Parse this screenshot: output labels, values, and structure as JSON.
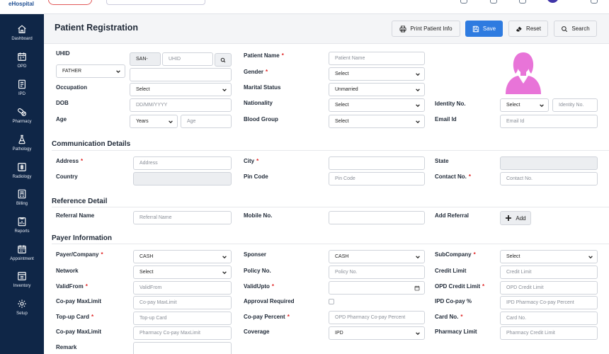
{
  "app": {
    "logo_text": "eHospital"
  },
  "sidebar": {
    "items": [
      {
        "label": "Dashboard",
        "icon": "home-icon"
      },
      {
        "label": "OPD",
        "icon": "calendar-icon"
      },
      {
        "label": "IPD",
        "icon": "document-icon"
      },
      {
        "label": "Pharmacy",
        "icon": "pills-icon"
      },
      {
        "label": "Pathology",
        "icon": "flask-icon"
      },
      {
        "label": "Radiology",
        "icon": "radiology-icon"
      },
      {
        "label": "Billing",
        "icon": "billing-icon"
      },
      {
        "label": "Reports",
        "icon": "reports-icon"
      },
      {
        "label": "Appointment",
        "icon": "appointment-icon"
      },
      {
        "label": "Inventory",
        "icon": "inventory-icon"
      },
      {
        "label": "Setup",
        "icon": "gear-icon"
      }
    ]
  },
  "header": {
    "title": "Patient Registration",
    "print_label": "Print Patient Info",
    "save_label": "Save",
    "reset_label": "Reset",
    "search_label": "Search"
  },
  "patient": {
    "uhid_label": "UHID",
    "uhid_prefix": "SAN-",
    "uhid_placeholder": "UHID",
    "relation_value": "FATHER",
    "patient_name_label": "Patient Name",
    "patient_name_placeholder": "Patient Name",
    "gender_label": "Gender",
    "gender_value": "Select",
    "occupation_label": "Occupation",
    "occupation_value": "Select",
    "marital_label": "Marital Status",
    "marital_value": "Unmarried",
    "dob_label": "DOB",
    "dob_placeholder": "DD/MM/YYYY",
    "nationality_label": "Nationality",
    "nationality_value": "Select",
    "identity_label": "Identity No.",
    "identity_type_value": "Select",
    "identity_placeholder": "Identity No.",
    "age_label": "Age",
    "age_unit_value": "Years",
    "age_placeholder": "Age",
    "blood_label": "Blood Group",
    "blood_value": "Select",
    "email_label": "Email Id",
    "email_placeholder": "Email Id"
  },
  "communication": {
    "title": "Communication Details",
    "address_label": "Address",
    "address_placeholder": "Address",
    "city_label": "City",
    "state_label": "State",
    "country_label": "Country",
    "pincode_label": "Pin Code",
    "pincode_placeholder": "Pin Code",
    "contact_label": "Contact No.",
    "contact_placeholder": "Contact No."
  },
  "reference": {
    "title": "Reference Detail",
    "referral_label": "Referral Name",
    "referral_placeholder": "Referral Name",
    "mobile_label": "Mobile No.",
    "add_referral_label": "Add Referral",
    "add_button": "Add"
  },
  "payer": {
    "title": "Payer Information",
    "payer_label": "Payer/Company",
    "payer_value": "CASH",
    "sponser_label": "Sponser",
    "sponser_value": "CASH",
    "subcompany_label": "SubCompany",
    "subcompany_value": "Select",
    "network_label": "Network",
    "network_value": "Select",
    "policy_label": "Policy No.",
    "policy_placeholder": "Policy No.",
    "credit_limit_label": "Credit Limit",
    "credit_limit_placeholder": "Credit Limit",
    "validfrom_label": "ValidFrom",
    "validfrom_placeholder": "ValidFrom",
    "validupto_label": "ValidUpto",
    "opd_credit_label": "OPD Credit Limit",
    "opd_credit_placeholder": "OPD Credit Limit",
    "copay_max_label": "Co-pay MaxLimit",
    "copay_max_placeholder": "Co-pay MaxLimit",
    "approval_label": "Approval Required",
    "ipd_copay_label": "IPD Co-pay %",
    "ipd_copay_placeholder": "IPD Pharmacy Co-pay Percent",
    "topup_label": "Top-up Card",
    "topup_placeholder": "Top-up Card",
    "copay_percent_label": "Co-pay Percent",
    "copay_percent_placeholder": "OPD Pharmacy Co-pay Percent",
    "cardno_label": "Card No.",
    "cardno_placeholder": "Card No.",
    "copay_max2_label": "Co-pay MaxLimit",
    "copay_max2_placeholder": "Pharmacy Co-pay MaxLimit",
    "coverage_label": "Coverage",
    "coverage_value": "IPD",
    "pharmacy_limit_label": "Pharmacy Limit",
    "pharmacy_limit_placeholder": "Pharmacy Credit Limit",
    "remark_label": "Remark"
  },
  "colors": {
    "sidebar": "#0f2647",
    "primary": "#2e7be0",
    "required": "#e02424",
    "avatar": "#e874d8"
  }
}
